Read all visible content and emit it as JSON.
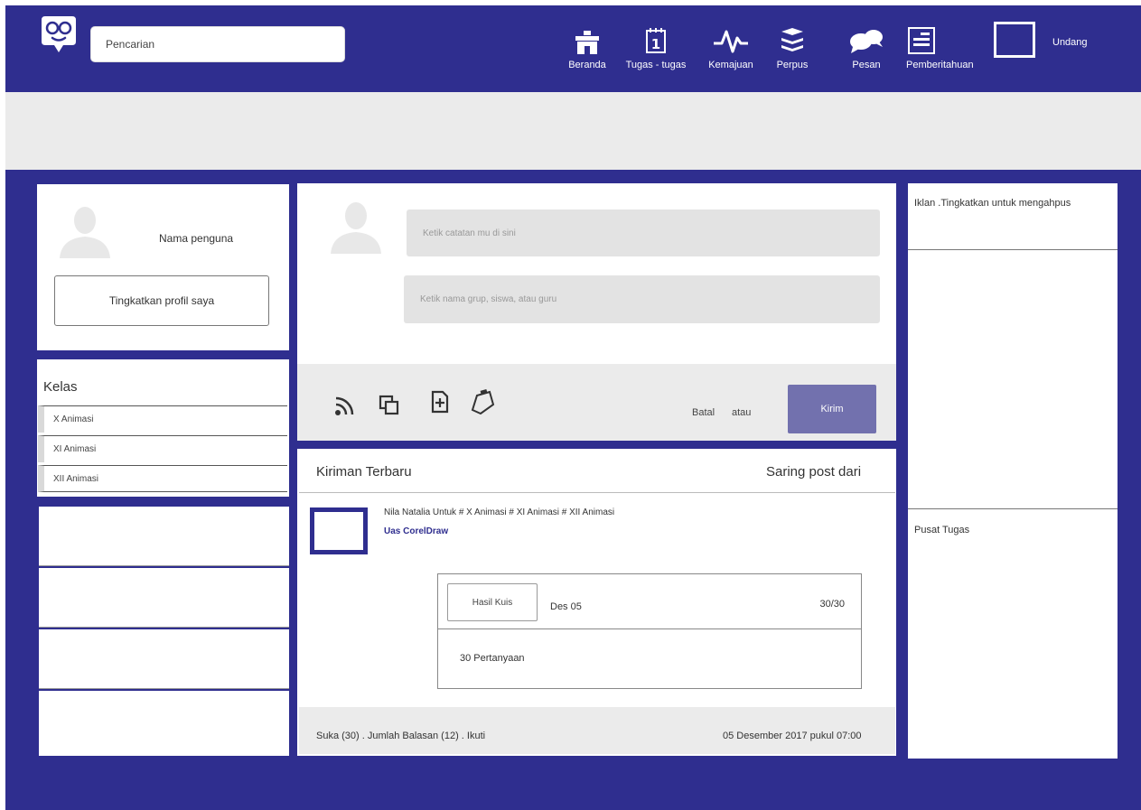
{
  "header": {
    "search_placeholder": "Pencarian",
    "nav": [
      {
        "label": "Beranda",
        "icon": "school-icon"
      },
      {
        "label": "Tugas - tugas",
        "icon": "calendar-icon"
      },
      {
        "label": "Kemajuan",
        "icon": "pulse-icon"
      },
      {
        "label": "Perpus",
        "icon": "books-icon"
      },
      {
        "label": "Pesan",
        "icon": "chat-bubbles-icon"
      },
      {
        "label": "Pemberitahuan",
        "icon": "notification-icon"
      }
    ],
    "invite_label": "Undang"
  },
  "profile": {
    "name": "Nama penguna",
    "upgrade_button": "Tingkatkan profil saya"
  },
  "classes": {
    "title": "Kelas",
    "items": [
      "X Animasi",
      "XI Animasi",
      "XII Animasi"
    ]
  },
  "composer": {
    "note_placeholder": "Ketik catatan mu di sini",
    "recipient_placeholder": "Ketik nama grup, siswa, atau guru",
    "cancel_label": "Batal",
    "or_label": "atau",
    "send_label": "Kirim"
  },
  "feed": {
    "title": "Kiriman Terbaru",
    "filter_label": "Saring post dari",
    "post": {
      "meta": "Nila Natalia Untuk # X Animasi # XI Animasi # XII Animasi",
      "subject": "Uas CorelDraw",
      "quiz": {
        "button": "Hasil Kuis",
        "date": "Des 05",
        "score": "30/30",
        "questions": "30 Pertanyaan"
      },
      "footer_actions": "Suka (30) . Jumlah Balasan (12) . Ikuti",
      "timestamp": "05 Desember 2017 pukul 07:00"
    }
  },
  "sidebar_right": {
    "ad_text": "Iklan .Tingkatkan untuk mengahpus",
    "task_center": "Pusat Tugas"
  },
  "colors": {
    "brand": "#2f2e8f",
    "send_button": "#7271ae",
    "grey_panel": "#ebebeb"
  }
}
